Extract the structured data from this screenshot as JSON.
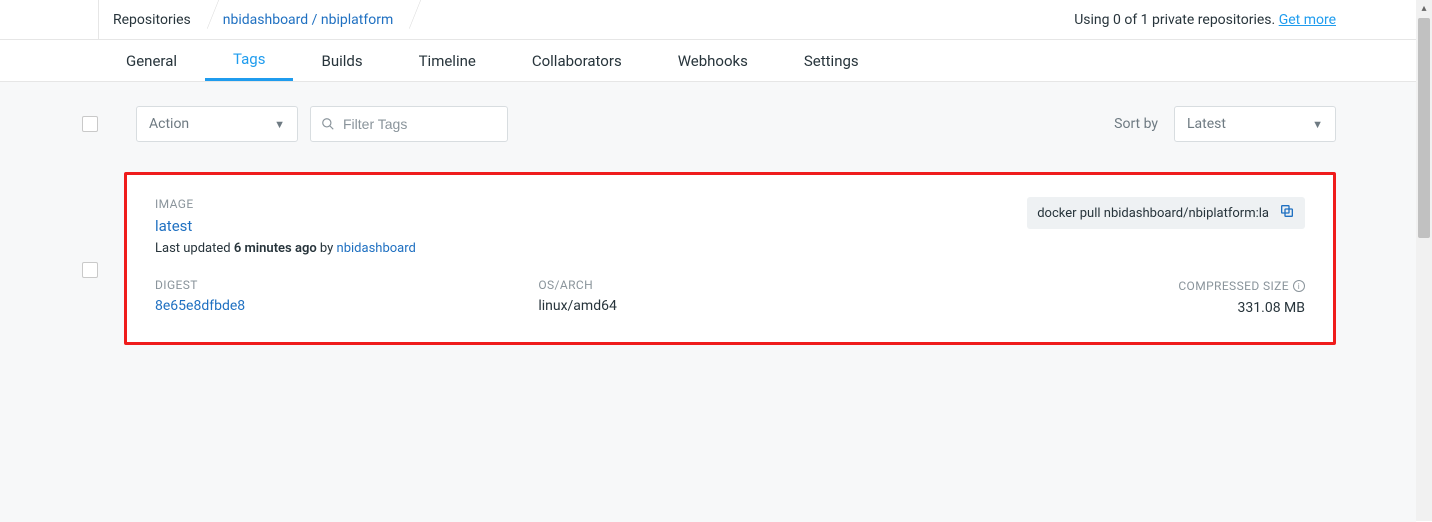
{
  "breadcrumb": {
    "root": "Repositories",
    "path": "nbidashboard / nbiplatform"
  },
  "top_right": {
    "usage": "Using 0 of 1 private repositories. ",
    "get_more": "Get more"
  },
  "tabs": {
    "general": "General",
    "tags": "Tags",
    "builds": "Builds",
    "timeline": "Timeline",
    "collaborators": "Collaborators",
    "webhooks": "Webhooks",
    "settings": "Settings"
  },
  "toolbar": {
    "action_label": "Action",
    "filter_placeholder": "Filter Tags",
    "sort_by_label": "Sort by",
    "sort_value": "Latest"
  },
  "tag": {
    "image_label": "IMAGE",
    "name": "latest",
    "updated_prefix": "Last updated ",
    "updated_ago": "6 minutes ago",
    "updated_by_word": " by ",
    "updated_by": "nbidashboard",
    "digest_label": "DIGEST",
    "digest": "8e65e8dfbde8",
    "osarch_label": "OS/ARCH",
    "osarch": "linux/amd64",
    "size_label": "COMPRESSED SIZE",
    "size": "331.08 MB",
    "pull_cmd": "docker pull nbidashboard/nbiplatform:la"
  }
}
